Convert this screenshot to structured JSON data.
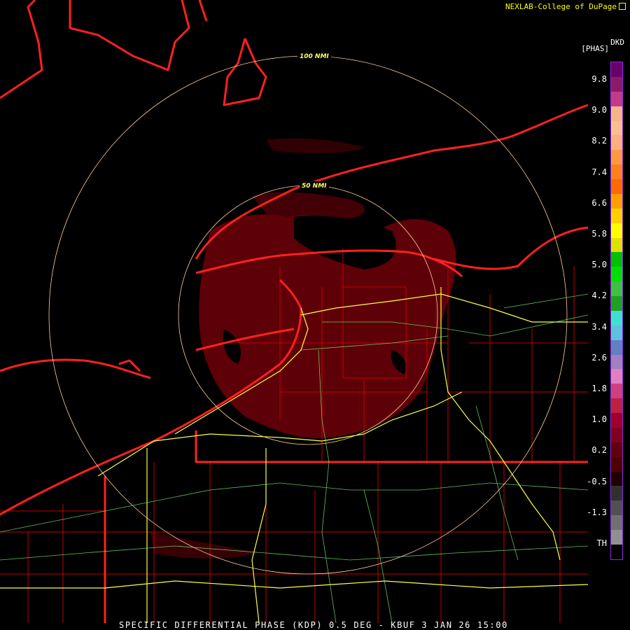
{
  "credit": {
    "text": "NEXLAB-College of DuPage",
    "icon": "external-link-icon"
  },
  "product": {
    "footer": "SPECIFIC DIFFERENTIAL PHASE (KDP) 0.5 DEG - KBUF 3 JAN 26 15:00"
  },
  "rings": [
    {
      "label": "100 NMI"
    },
    {
      "label": "50 NMI"
    }
  ],
  "legend": {
    "code": "DKD",
    "unit": "[PHAS]",
    "ticks": [
      "9.8",
      "9.0",
      "8.2",
      "7.4",
      "6.6",
      "5.8",
      "5.0",
      "4.2",
      "3.4",
      "2.6",
      "1.8",
      "1.0",
      "0.2",
      "-0.5",
      "-1.3",
      "TH"
    ],
    "colors": [
      "#6a006a",
      "#8b1a6a",
      "#c23a8a",
      "#f5b58a",
      "#f8c090",
      "#fbb080",
      "#ff9a40",
      "#ff8020",
      "#ff6a00",
      "#ffa000",
      "#ffd000",
      "#ffff00",
      "#e0e000",
      "#00c000",
      "#00e000",
      "#40c040",
      "#20a020",
      "#40e0d0",
      "#60c0e0",
      "#6080c0",
      "#a080c0",
      "#e080c0",
      "#d04080",
      "#c02040",
      "#a00030",
      "#800020",
      "#600010",
      "#500000",
      "#200000",
      "#303030",
      "#505050",
      "#707070",
      "#909090",
      "#000000"
    ],
    "panel_border": "#8a2be2"
  },
  "colors": {
    "state_border": "#ff2020",
    "county": "#c80000",
    "highway": "#ffff40",
    "road": "#80ff80",
    "ring": "#ffd0a0",
    "echo": "#6a0008"
  }
}
